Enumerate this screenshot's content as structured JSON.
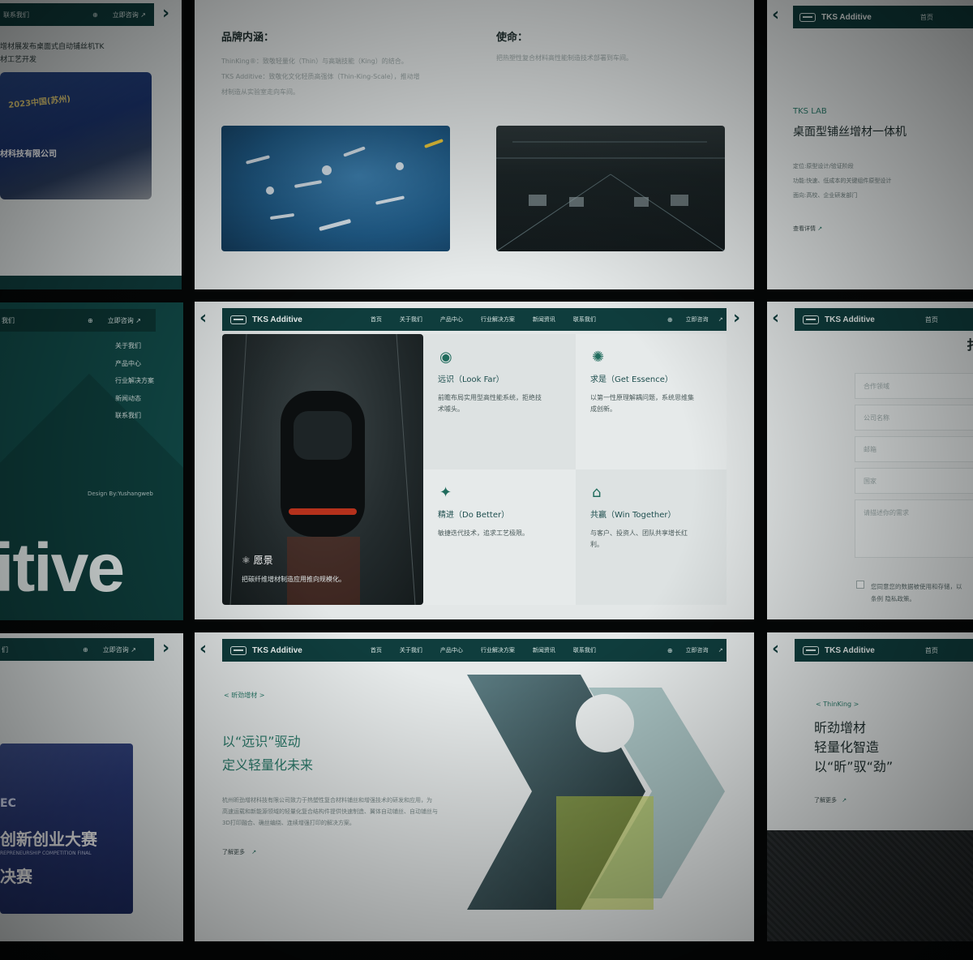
{
  "brand": {
    "name": "TKS Additive"
  },
  "nav": {
    "links": [
      "首页",
      "关于我们",
      "产品中心",
      "行业解决方案",
      "新闻资讯",
      "联系我们"
    ],
    "consult": "立即咨询",
    "contact_short": "联系我们",
    "home": "首页"
  },
  "news_panel": {
    "headline_1": "增材展发布桌面式自动铺丝机TK",
    "headline_2": "材工艺开发",
    "banner_1": "2023中国(苏州)",
    "banner_2": "材科技有限公司"
  },
  "brand_panel": {
    "connotation_title": "品牌内涵：",
    "connotation_1": "ThinKing®：致敬轻量化（Thin）与高端技能（King）的结合。",
    "connotation_2": "TKS Additive：致敬化文化轻质高强体（Thin-King-Scale），推动增",
    "connotation_3": "材制造从实验室走向车间。",
    "mission_title": "使命：",
    "mission_text": "把热塑性复合材料高性能制造技术部署到车间。"
  },
  "lab_panel": {
    "tag": "TKS LAB",
    "title": "桌面型铺丝增材一体机",
    "spec_1": "定位:原型设计/验证阶段",
    "spec_2": "功能:快速、低成本的关键组件原型设计",
    "spec_3": "面向:高校、企业研发部门",
    "more": "查看详情"
  },
  "menu_panel": {
    "items": [
      "关于我们",
      "产品中心",
      "行业解决方案",
      "新闻动态",
      "联系我们"
    ],
    "credit": "Design By:Yushangweb",
    "big_word": "itive",
    "contact_short": "我们"
  },
  "values_panel": {
    "vision_title": "愿景",
    "vision_text": "把碳纤维增材制造应用推向规模化。",
    "cards": [
      {
        "title": "远识（Look Far）",
        "text_1": "前瞻布局实用型高性能系统，拒绝技",
        "text_2": "术噱头。"
      },
      {
        "title": "求是（Get Essence）",
        "text_1": "以第一性原理解耦问题，系统思维集",
        "text_2": "成创新。"
      },
      {
        "title": "精进（Do Better）",
        "text_1": "敏捷迭代技术，追求工艺极限。",
        "text_2": ""
      },
      {
        "title": "共赢（Win Together）",
        "text_1": "与客户、投资人、团队共享增长红",
        "text_2": "利。"
      }
    ]
  },
  "form_panel": {
    "title": "扌",
    "fields": [
      "合作领域",
      "公司名称",
      "邮箱",
      "国家"
    ],
    "message": "请描述你的需求",
    "consent_1": "您同意您的数据被使用和存储，以",
    "consent_2": "条例 隐私政策。"
  },
  "event_panel": {
    "line_1": "EC",
    "line_2": "创新创业大赛",
    "line_3": "REPRENEURSHIP COMPETITION FINAL",
    "line_4": "决赛",
    "contact_short": "们"
  },
  "hero_panel": {
    "tag": "< 昕劲增材 >",
    "title_1": "以“远识”驱动",
    "title_2": "定义轻量化未来",
    "body_1": "杭州昕劲增材科技有限公司致力于热塑性复合材料铺丝和增强技术的研发和应用，为",
    "body_2": "高速运载和新能源领域的轻量化复合结构件提供快速制造、翼体自动铺丝、自动铺丝与",
    "body_3": "3D打印融合、确丝编绕、连续增强打印的解决方案。",
    "more": "了解更多"
  },
  "thinking_panel": {
    "tag": "< ThinKing >",
    "title_1": "昕劲增材",
    "title_2": "轻量化智造",
    "title_3": "以“昕”驭“劲”",
    "more": "了解更多"
  },
  "colors": {
    "brand": "#0f3d3d",
    "accent": "#1f6b5c",
    "background": "#050707"
  },
  "icons": [
    "globe-icon",
    "arrow-up-right-icon",
    "chevron-right-icon",
    "chevron-left-icon",
    "eye-hand-icon",
    "lightbulb-icon",
    "person-star-icon",
    "handshake-icon",
    "atom-icon"
  ]
}
